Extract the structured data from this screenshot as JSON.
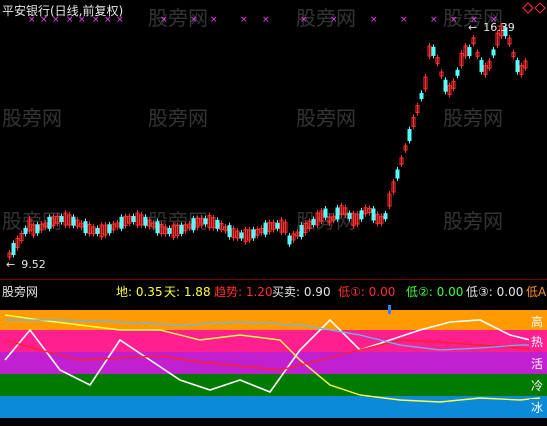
{
  "window": {
    "title": "平安银行(日线,前复权)"
  },
  "price_panel": {
    "high_label": "16.39",
    "low_label": "9.52",
    "high_arrow": "←",
    "low_arrow": "←"
  },
  "watermark": {
    "text": "股旁网"
  },
  "indicator_panel": {
    "name": "股旁网",
    "values": [
      {
        "label": "地:",
        "value": "0.35",
        "color": "#ffff40"
      },
      {
        "label": "天:",
        "value": "1.88",
        "color": "#ffff40"
      },
      {
        "label": "趋势:",
        "value": "1.20",
        "color": "#ff3030"
      },
      {
        "label": "买卖:",
        "value": "0.90",
        "color": "#e6e6e6"
      },
      {
        "label": "低①:",
        "value": "0.00",
        "color": "#ff3030"
      },
      {
        "label": "低②:",
        "value": "0.00",
        "color": "#40ff40"
      },
      {
        "label": "低③:",
        "value": "0.00",
        "color": "#e6e6e6"
      },
      {
        "label": "低A:",
        "value": "",
        "color": "#ff9020"
      }
    ],
    "zones": [
      {
        "label": "高",
        "color": "#ff9a00"
      },
      {
        "label": "热",
        "color": "#ff1f8f"
      },
      {
        "label": "活",
        "color": "#c020d0"
      },
      {
        "label": "冷",
        "color": "#007a00"
      },
      {
        "label": "冰",
        "color": "#0a8ad8"
      }
    ]
  },
  "colors": {
    "up_candle": "#ff3030",
    "down_candle": "#54ffff",
    "marker": "#ff40ff"
  }
}
